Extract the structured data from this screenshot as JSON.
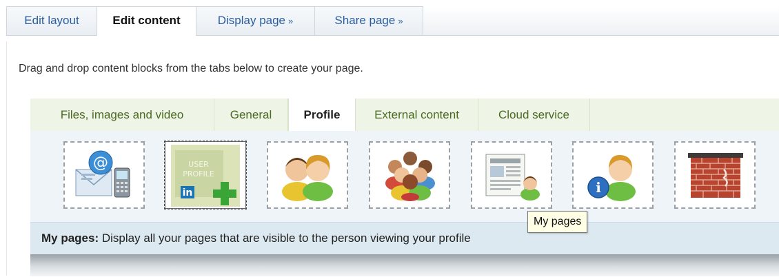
{
  "top_tabs": [
    {
      "label": "Edit layout"
    },
    {
      "label": "Edit content"
    },
    {
      "label": "Display page",
      "arrow": "»"
    },
    {
      "label": "Share page",
      "arrow": "»"
    }
  ],
  "instruction": "Drag and drop content blocks from the tabs below to create your page.",
  "sub_tabs": [
    {
      "label": "Files, images and video"
    },
    {
      "label": "General"
    },
    {
      "label": "Profile"
    },
    {
      "label": "External content"
    },
    {
      "label": "Cloud service"
    }
  ],
  "blocks": [
    {
      "icon": "contact-info-icon"
    },
    {
      "icon": "linkedin-user-profile-icon",
      "text1": "USER",
      "text2": "PROFILE",
      "badge": "in"
    },
    {
      "icon": "friends-icon"
    },
    {
      "icon": "groups-icon"
    },
    {
      "icon": "my-pages-icon"
    },
    {
      "icon": "profile-info-icon"
    },
    {
      "icon": "wall-icon"
    }
  ],
  "tooltip": "My pages",
  "description": {
    "label": "My pages:",
    "text": " Display all your pages that are visible to the person viewing your profile"
  },
  "colors": {
    "link_blue": "#2a5d9f",
    "subtab_green": "#4b6a21",
    "block_area": "#eef4f8",
    "description_bg": "#dde9f1"
  }
}
